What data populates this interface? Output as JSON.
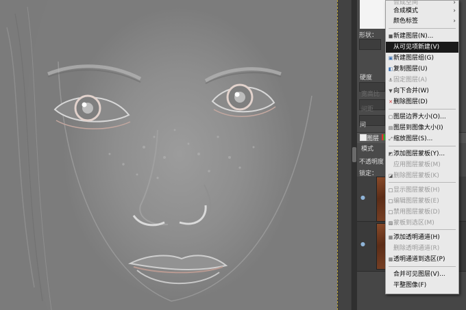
{
  "menu": {
    "items": [
      {
        "label": "合成空间",
        "icon": "",
        "enabled": false,
        "highlight": false,
        "submenu": true
      },
      {
        "label": "合成模式",
        "icon": "",
        "enabled": true,
        "highlight": false,
        "submenu": true
      },
      {
        "label": "颜色标签",
        "icon": "",
        "enabled": true,
        "highlight": false,
        "submenu": true
      },
      {
        "label": "新建图层(N)...",
        "icon": "new-layer-icon",
        "enabled": true,
        "highlight": false,
        "submenu": false
      },
      {
        "label": "从可见项新建(V)",
        "icon": "",
        "enabled": true,
        "highlight": true,
        "submenu": false
      },
      {
        "label": "新建图层组(G)",
        "icon": "new-group-icon",
        "enabled": true,
        "highlight": false,
        "submenu": false
      },
      {
        "label": "复制图层(U)",
        "icon": "duplicate-icon",
        "enabled": true,
        "highlight": false,
        "submenu": false
      },
      {
        "label": "固定图层(A)",
        "icon": "anchor-icon",
        "enabled": false,
        "highlight": false,
        "submenu": false
      },
      {
        "label": "向下合并(W)",
        "icon": "merge-down-icon",
        "enabled": true,
        "highlight": false,
        "submenu": false
      },
      {
        "label": "删除图层(D)",
        "icon": "delete-icon",
        "enabled": true,
        "highlight": false,
        "submenu": false
      },
      {
        "label": "图层边界大小(O)...",
        "icon": "boundary-icon",
        "enabled": true,
        "highlight": false,
        "submenu": false
      },
      {
        "label": "图层到图像大小(I)",
        "icon": "to-image-size-icon",
        "enabled": true,
        "highlight": false,
        "submenu": false
      },
      {
        "label": "缩放图层(S)...",
        "icon": "scale-icon",
        "enabled": true,
        "highlight": false,
        "submenu": false
      },
      {
        "label": "添加图层蒙板(Y)...",
        "icon": "add-mask-icon",
        "enabled": true,
        "highlight": false,
        "submenu": false
      },
      {
        "label": "应用图层蒙板(M)",
        "icon": "",
        "enabled": false,
        "highlight": false,
        "submenu": false
      },
      {
        "label": "删除图层蒙板(K)",
        "icon": "delete-mask-icon",
        "enabled": false,
        "highlight": false,
        "submenu": false
      },
      {
        "label": "显示图层蒙板(H)",
        "icon": "checkbox-icon",
        "enabled": false,
        "highlight": false,
        "submenu": false
      },
      {
        "label": "编辑图层蒙板(E)",
        "icon": "checkbox-icon",
        "enabled": false,
        "highlight": false,
        "submenu": false
      },
      {
        "label": "禁用图层蒙板(D)",
        "icon": "checkbox-icon",
        "enabled": false,
        "highlight": false,
        "submenu": false
      },
      {
        "label": "蒙板到选区(M)",
        "icon": "mask-to-selection-icon",
        "enabled": false,
        "highlight": false,
        "submenu": false
      },
      {
        "label": "添加透明通道(H)",
        "icon": "add-alpha-icon",
        "enabled": true,
        "highlight": false,
        "submenu": false
      },
      {
        "label": "删除透明通道(R)",
        "icon": "",
        "enabled": false,
        "highlight": false,
        "submenu": false
      },
      {
        "label": "透明通道到选区(P)",
        "icon": "alpha-to-selection-icon",
        "enabled": true,
        "highlight": false,
        "submenu": false
      },
      {
        "label": "合并可见图层(V)...",
        "icon": "",
        "enabled": true,
        "highlight": false,
        "submenu": false
      },
      {
        "label": "平整图像(F)",
        "icon": "",
        "enabled": true,
        "highlight": false,
        "submenu": false
      }
    ]
  },
  "panel": {
    "shape_label": "形状：",
    "hardness_label": "硬度",
    "dim1": "宽高比",
    "dim2": "间距",
    "dim3": "间",
    "layers_tab": "图层",
    "mode_label": "模式",
    "opacity_label": "不透明度",
    "lock_label": "锁定："
  }
}
